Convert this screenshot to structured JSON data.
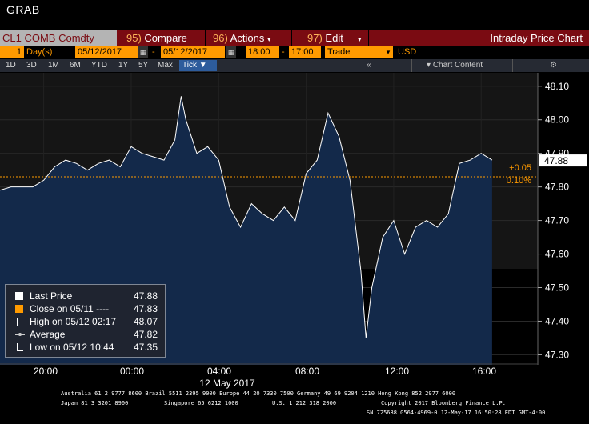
{
  "window": {
    "title": "GRAB"
  },
  "toolbar": {
    "ticker": "CL1 COMB Comdty",
    "compare_num": "95)",
    "compare_label": "Compare",
    "actions_num": "96)",
    "actions_label": "Actions",
    "edit_num": "97)",
    "edit_label": "Edit",
    "title": "Intraday Price Chart"
  },
  "controls": {
    "period_value": "1",
    "period_unit": "Day(s)",
    "start_date": "05/12/2017",
    "dash": "-",
    "end_date": "05/12/2017",
    "start_time": "18:00",
    "end_time": "17:00",
    "field": "Trade",
    "currency": "USD"
  },
  "ranges": {
    "items": [
      "1D",
      "3D",
      "1M",
      "6M",
      "YTD",
      "1Y",
      "5Y",
      "Max"
    ],
    "tick_label": "Tick",
    "collapse_label": "«",
    "chart_content_label": "Chart Content"
  },
  "legend": {
    "last_price_label": "Last Price",
    "last_price_value": "47.88",
    "close_label": "Close on 05/11 ----",
    "close_value": "47.83",
    "high_label": "High on 05/12 02:17",
    "high_value": "48.07",
    "average_label": "Average",
    "average_value": "47.82",
    "low_label": "Low on 05/12 10:44",
    "low_value": "47.35"
  },
  "chart_data": {
    "type": "area",
    "x": [
      "18:00",
      "18:30",
      "19:00",
      "19:30",
      "20:00",
      "20:30",
      "21:00",
      "21:30",
      "22:00",
      "22:30",
      "23:00",
      "23:30",
      "00:00",
      "00:30",
      "01:00",
      "01:30",
      "02:00",
      "02:17",
      "02:30",
      "03:00",
      "03:30",
      "04:00",
      "04:30",
      "05:00",
      "05:30",
      "06:00",
      "06:30",
      "07:00",
      "07:30",
      "08:00",
      "08:30",
      "09:00",
      "09:30",
      "10:00",
      "10:30",
      "10:44",
      "11:00",
      "11:30",
      "12:00",
      "12:30",
      "13:00",
      "13:30",
      "14:00",
      "14:30",
      "15:00",
      "15:30",
      "16:00",
      "16:30"
    ],
    "series": [
      {
        "values": [
          47.79,
          47.8,
          47.8,
          47.8,
          47.82,
          47.86,
          47.88,
          47.87,
          47.85,
          47.87,
          47.88,
          47.86,
          47.92,
          47.9,
          47.89,
          47.88,
          47.94,
          48.07,
          48.0,
          47.9,
          47.92,
          47.88,
          47.74,
          47.68,
          47.75,
          47.72,
          47.7,
          47.74,
          47.7,
          47.84,
          47.88,
          48.02,
          47.95,
          47.82,
          47.55,
          47.35,
          47.5,
          47.65,
          47.7,
          47.6,
          47.68,
          47.7,
          47.68,
          47.72,
          47.87,
          47.88,
          47.9,
          47.88
        ]
      }
    ],
    "previous_close": 47.83,
    "last_price": 47.88,
    "change_label": "+0.05",
    "change_pct_label": "0.10%",
    "xtick_labels": [
      "20:00",
      "00:00",
      "04:00",
      "08:00",
      "12:00",
      "16:00"
    ],
    "date_label": "12 May 2017",
    "yticks": [
      "48.10",
      "48.00",
      "47.90",
      "47.80",
      "47.70",
      "47.60",
      "47.50",
      "47.40",
      "47.30"
    ],
    "ylim": [
      47.27,
      48.14
    ],
    "colors": {
      "area": "#13294a",
      "line": "#ffffff",
      "close_line": "#ff9a00",
      "price_label": "#ffffff"
    }
  },
  "footer": {
    "line1": "Australia 61 2 9777 8600 Brazil 5511 2395 9000 Europe 44 20 7330 7500 Germany 49 69 9204 1210 Hong Kong 852 2977 6000",
    "line2a": "Japan 81 3 3201 8900",
    "line2b": "Singapore 65 6212 1000",
    "line2c": "U.S. 1 212 318 2000",
    "line2d": "Copyright 2017 Bloomberg Finance L.P.",
    "line3": "SN 725688 G564-4969-0 12-May-17 16:50:28 EDT  GMT-4:00"
  }
}
